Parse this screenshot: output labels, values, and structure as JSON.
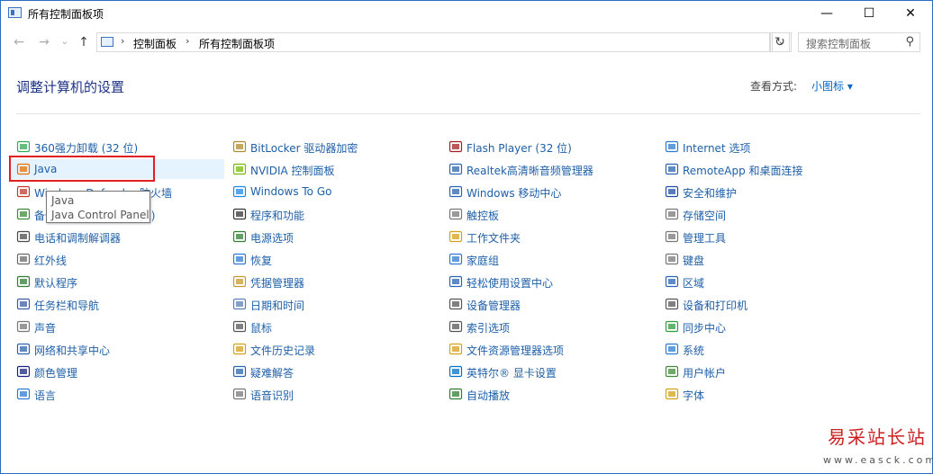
{
  "window": {
    "title": "所有控制面板项",
    "minimize": "—",
    "maximize": "☐",
    "close": "✕"
  },
  "nav": {
    "back": "←",
    "forward": "→",
    "recent": "⌄",
    "up": "↑",
    "breadcrumb": [
      "控制面板",
      "所有控制面板项"
    ],
    "separator": "›",
    "refresh": "↻",
    "search_placeholder": "搜索控制面板"
  },
  "header": {
    "title": "调整计算机的设置",
    "view_by_label": "查看方式:",
    "view_by_value": "小图标 ▾"
  },
  "columns": [
    [
      {
        "label": "360强力卸载 (32 位)",
        "icon": "uninstaller-icon",
        "color": "#34a853"
      },
      {
        "label": "Java",
        "icon": "java-icon",
        "color": "#e76f00"
      },
      {
        "label": "Windows Defender 防火墙",
        "icon": "firewall-icon",
        "color": "#c0392b"
      },
      {
        "label": "备份和还原(Windows 7)",
        "icon": "backup-icon",
        "color": "#3d8b37"
      },
      {
        "label": "电话和调制解调器",
        "icon": "phone-modem-icon",
        "color": "#4a4a4a"
      },
      {
        "label": "红外线",
        "icon": "infrared-icon",
        "color": "#6a6a6a"
      },
      {
        "label": "默认程序",
        "icon": "default-programs-icon",
        "color": "#2e7d32"
      },
      {
        "label": "任务栏和导航",
        "icon": "taskbar-icon",
        "color": "#3b5ba9"
      },
      {
        "label": "声音",
        "icon": "sound-icon",
        "color": "#777777"
      },
      {
        "label": "网络和共享中心",
        "icon": "network-icon",
        "color": "#2b63b0"
      },
      {
        "label": "颜色管理",
        "icon": "color-management-icon",
        "color": "#1a237e"
      },
      {
        "label": "语言",
        "icon": "language-icon",
        "color": "#2b7bd3"
      }
    ],
    [
      {
        "label": "BitLocker 驱动器加密",
        "icon": "bitlocker-icon",
        "color": "#b08a2e"
      },
      {
        "label": "NVIDIA 控制面板",
        "icon": "nvidia-icon",
        "color": "#76b900"
      },
      {
        "label": "Windows To Go",
        "icon": "windows-to-go-icon",
        "color": "#1e88e5"
      },
      {
        "label": "程序和功能",
        "icon": "programs-features-icon",
        "color": "#333333"
      },
      {
        "label": "电源选项",
        "icon": "power-options-icon",
        "color": "#2e7d32"
      },
      {
        "label": "恢复",
        "icon": "recovery-icon",
        "color": "#2b7bd3"
      },
      {
        "label": "凭据管理器",
        "icon": "credential-manager-icon",
        "color": "#c79a2b"
      },
      {
        "label": "日期和时间",
        "icon": "date-time-icon",
        "color": "#5b7fb8"
      },
      {
        "label": "鼠标",
        "icon": "mouse-icon",
        "color": "#555555"
      },
      {
        "label": "文件历史记录",
        "icon": "file-history-icon",
        "color": "#d4a017"
      },
      {
        "label": "疑难解答",
        "icon": "troubleshooting-icon",
        "color": "#2b63b0"
      },
      {
        "label": "语音识别",
        "icon": "speech-recognition-icon",
        "color": "#777777"
      }
    ],
    [
      {
        "label": "Flash Player (32 位)",
        "icon": "flash-player-icon",
        "color": "#a41e22"
      },
      {
        "label": "Realtek高清晰音频管理器",
        "icon": "realtek-audio-icon",
        "color": "#2b63b0"
      },
      {
        "label": "Windows 移动中心",
        "icon": "mobility-center-icon",
        "color": "#2b63b0"
      },
      {
        "label": "触控板",
        "icon": "touchpad-icon",
        "color": "#777777"
      },
      {
        "label": "工作文件夹",
        "icon": "work-folders-icon",
        "color": "#d4a017"
      },
      {
        "label": "家庭组",
        "icon": "homegroup-icon",
        "color": "#2b7bd3"
      },
      {
        "label": "轻松使用设置中心",
        "icon": "ease-of-access-icon",
        "color": "#2b63b0"
      },
      {
        "label": "设备管理器",
        "icon": "device-manager-icon",
        "color": "#555555"
      },
      {
        "label": "索引选项",
        "icon": "indexing-options-icon",
        "color": "#555555"
      },
      {
        "label": "文件资源管理器选项",
        "icon": "explorer-options-icon",
        "color": "#d4a017"
      },
      {
        "label": "英特尔® 显卡设置",
        "icon": "intel-graphics-icon",
        "color": "#0071c5"
      },
      {
        "label": "自动播放",
        "icon": "autoplay-icon",
        "color": "#2e7d32"
      }
    ],
    [
      {
        "label": "Internet 选项",
        "icon": "internet-options-icon",
        "color": "#2b7bd3"
      },
      {
        "label": "RemoteApp 和桌面连接",
        "icon": "remoteapp-icon",
        "color": "#2b63b0"
      },
      {
        "label": "安全和维护",
        "icon": "security-maintenance-icon",
        "color": "#1e4fa8"
      },
      {
        "label": "存储空间",
        "icon": "storage-spaces-icon",
        "color": "#777777"
      },
      {
        "label": "管理工具",
        "icon": "admin-tools-icon",
        "color": "#777777"
      },
      {
        "label": "键盘",
        "icon": "keyboard-icon",
        "color": "#777777"
      },
      {
        "label": "区域",
        "icon": "region-icon",
        "color": "#2b63b0"
      },
      {
        "label": "设备和打印机",
        "icon": "devices-printers-icon",
        "color": "#555555"
      },
      {
        "label": "同步中心",
        "icon": "sync-center-icon",
        "color": "#2e9d3a"
      },
      {
        "label": "系统",
        "icon": "system-icon",
        "color": "#2b7bd3"
      },
      {
        "label": "用户帐户",
        "icon": "user-accounts-icon",
        "color": "#3d8b37"
      },
      {
        "label": "字体",
        "icon": "fonts-icon",
        "color": "#d4a017"
      }
    ]
  ],
  "tooltip": {
    "line1": "Java",
    "line2": "Java Control Panel"
  },
  "watermark": {
    "text": "易采站长站",
    "url": "www.easck.com"
  }
}
